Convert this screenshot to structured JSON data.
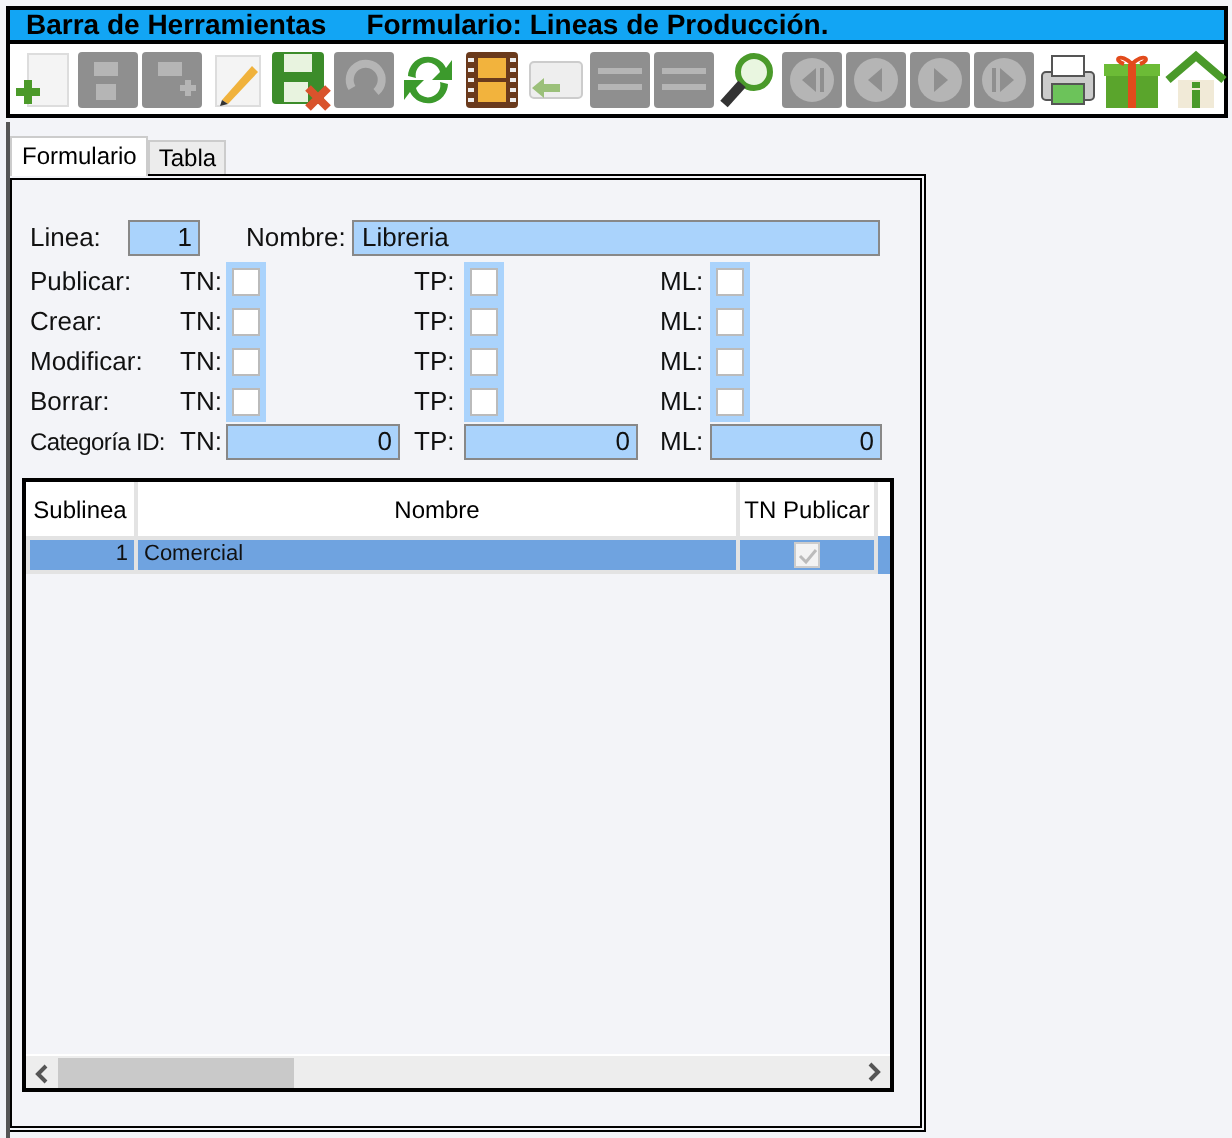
{
  "title_bar": {
    "toolbar_title": "Barra de Herramientas",
    "form_title": "Formulario: Lineas de Producción."
  },
  "toolbar": [
    {
      "kind": "add",
      "disabled": false
    },
    {
      "kind": "save",
      "disabled": true
    },
    {
      "kind": "save_add",
      "disabled": true
    },
    {
      "kind": "edit",
      "disabled": false
    },
    {
      "kind": "save_delete",
      "disabled": false
    },
    {
      "kind": "undo",
      "disabled": true
    },
    {
      "kind": "refresh",
      "disabled": false
    },
    {
      "kind": "film",
      "disabled": false
    },
    {
      "kind": "reply",
      "disabled": true
    },
    {
      "kind": "list_add",
      "disabled": true
    },
    {
      "kind": "list_remove",
      "disabled": true
    },
    {
      "kind": "search",
      "disabled": false
    },
    {
      "kind": "first",
      "disabled": true
    },
    {
      "kind": "previous",
      "disabled": true
    },
    {
      "kind": "next",
      "disabled": true
    },
    {
      "kind": "last",
      "disabled": true
    },
    {
      "kind": "print",
      "disabled": false
    },
    {
      "kind": "gift",
      "disabled": false
    },
    {
      "kind": "home",
      "disabled": false
    }
  ],
  "tabs": [
    {
      "label": "Formulario",
      "selected": true
    },
    {
      "label": "Tabla",
      "selected": false
    }
  ],
  "form": {
    "linea": {
      "label": "Linea:",
      "value": "1"
    },
    "nombre": {
      "label": "Nombre:",
      "value": "Libreria"
    },
    "permission_rows": [
      {
        "label": "Publicar:",
        "checks": [
          {
            "label": "TN:",
            "checked": false
          },
          {
            "label": "TP:",
            "checked": false
          },
          {
            "label": "ML:",
            "checked": false
          }
        ]
      },
      {
        "label": "Crear:",
        "checks": [
          {
            "label": "TN:",
            "checked": false
          },
          {
            "label": "TP:",
            "checked": false
          },
          {
            "label": "ML:",
            "checked": false
          }
        ]
      },
      {
        "label": "Modificar:",
        "checks": [
          {
            "label": "TN:",
            "checked": false
          },
          {
            "label": "TP:",
            "checked": false
          },
          {
            "label": "ML:",
            "checked": false
          }
        ]
      },
      {
        "label": "Borrar:",
        "checks": [
          {
            "label": "TN:",
            "checked": false
          },
          {
            "label": "TP:",
            "checked": false
          },
          {
            "label": "ML:",
            "checked": false
          }
        ]
      }
    ],
    "categoria": {
      "label": "Categoría ID:",
      "fields": [
        {
          "label": "TN:",
          "value": "0"
        },
        {
          "label": "TP:",
          "value": "0"
        },
        {
          "label": "ML:",
          "value": "0"
        }
      ]
    }
  },
  "table": {
    "columns": [
      "Sublinea",
      "Nombre",
      "TN Publicar"
    ],
    "rows": [
      {
        "sublinea": "1",
        "nombre": "Comercial",
        "tn_publicar": true,
        "selected": true
      }
    ]
  }
}
